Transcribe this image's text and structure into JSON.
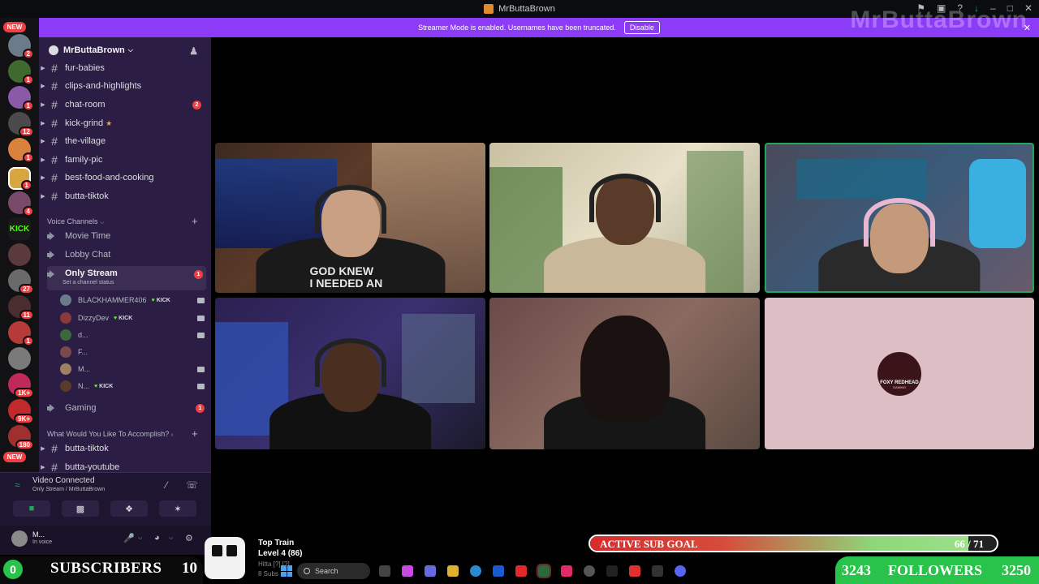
{
  "window": {
    "title": "MrButtaBrown",
    "watermark": "MrButtaBrown"
  },
  "banner": {
    "text": "Streamer Mode is enabled. Usernames have been truncated.",
    "button": "Disable"
  },
  "rail": {
    "new_top": "NEW",
    "new_bottom": "NEW",
    "badges": [
      "2",
      "1",
      "1",
      "12",
      "1",
      "1",
      "4",
      "27",
      "11",
      "1",
      "1K+",
      "9K+",
      "180"
    ]
  },
  "server": {
    "name": "MrButtaBrown"
  },
  "text_channels": [
    {
      "name": "fur-babies",
      "mention": ""
    },
    {
      "name": "clips-and-highlights",
      "mention": ""
    },
    {
      "name": "chat-room",
      "mention": "2"
    },
    {
      "name": "kick-grind",
      "mention": ""
    },
    {
      "name": "the-village",
      "mention": ""
    },
    {
      "name": "family-pic",
      "mention": ""
    },
    {
      "name": "best-food-and-cooking",
      "mention": ""
    },
    {
      "name": "butta-tiktok",
      "mention": ""
    }
  ],
  "voice_category": "Voice Channels",
  "voice_channels": [
    {
      "name": "Movie Time"
    },
    {
      "name": "Lobby Chat"
    },
    {
      "name": "Only Stream",
      "status": "Set a channel status",
      "mention": "1"
    },
    {
      "name": "Gaming",
      "mention": "1"
    }
  ],
  "voice_users": [
    {
      "name": "BLACKHAMMER406",
      "tag": "KICK"
    },
    {
      "name": "DizzyDev",
      "tag": "KICK"
    },
    {
      "name": "d...",
      "tag": ""
    },
    {
      "name": "F...",
      "tag": ""
    },
    {
      "name": "M...",
      "tag": ""
    },
    {
      "name": "N...",
      "tag": "KICK"
    }
  ],
  "category2": "What Would You Like To Accomplish?",
  "lower_channels": [
    "butta-tiktok",
    "butta-youtube"
  ],
  "voice_connection": {
    "status": "Video Connected",
    "channel": "Only Stream / MrButtaBrown"
  },
  "user": {
    "name": "M...",
    "status": "In voice"
  },
  "tiles": [
    {
      "shirt_text": "GOD KNEW\nI NEEDED AN"
    },
    {},
    {},
    {},
    {},
    {
      "logo_line1": "FOXY REDHEAD",
      "logo_line2": "GAMING"
    }
  ],
  "overlay": {
    "sub_current": "0",
    "sub_label": "SUBSCRIBERS",
    "sub_goal": "10",
    "train_title": "Top Train",
    "train_level": "Level 4 (86)",
    "train_extra1": "Hitta [?] [?]",
    "train_extra2": "8 Subs",
    "goal_label": "ACTIVE SUB GOAL",
    "goal_value": "66 / 71",
    "goal_fraction": 0.93,
    "followers_current": "3243",
    "followers_label": "FOLLOWERS",
    "followers_goal": "3250"
  },
  "taskbar": {
    "search": "Search"
  },
  "colors": {
    "accent": "#8c3cf6",
    "sidebar": "#2b1d44",
    "green": "#29c24a",
    "mention": "#f23f43"
  }
}
